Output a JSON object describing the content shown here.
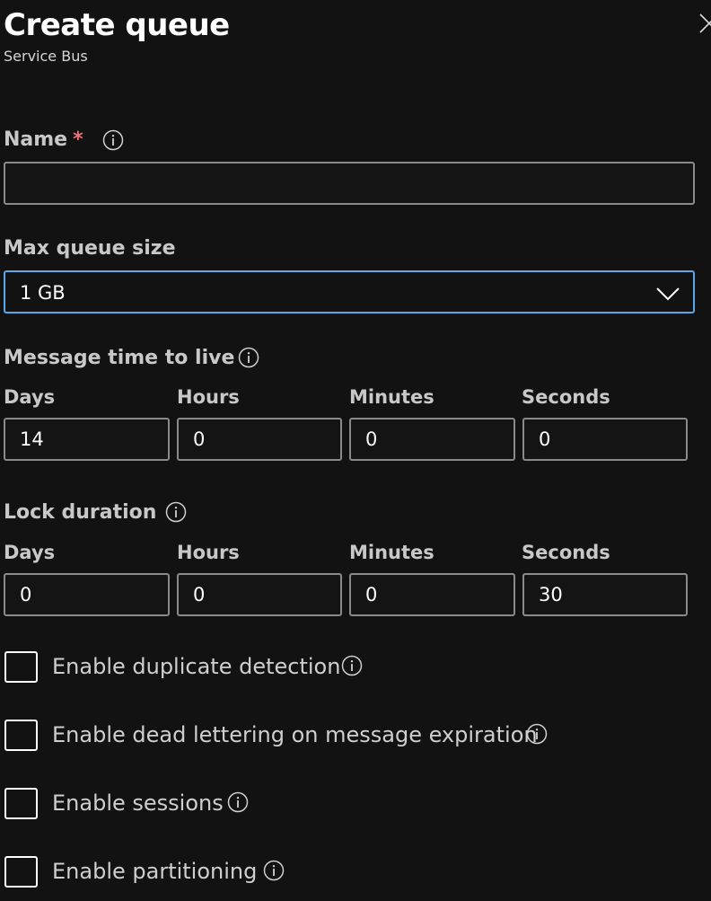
{
  "header": {
    "title": "Create queue",
    "subtitle": "Service Bus"
  },
  "name_field": {
    "label": "Name",
    "required_marker": "*",
    "value": ""
  },
  "max_queue_size": {
    "label": "Max queue size",
    "selected": "1 GB"
  },
  "message_ttl": {
    "label": "Message time to live",
    "units": {
      "days": "Days",
      "hours": "Hours",
      "minutes": "Minutes",
      "seconds": "Seconds"
    },
    "values": {
      "days": "14",
      "hours": "0",
      "minutes": "0",
      "seconds": "0"
    }
  },
  "lock_duration": {
    "label": "Lock duration",
    "units": {
      "days": "Days",
      "hours": "Hours",
      "minutes": "Minutes",
      "seconds": "Seconds"
    },
    "values": {
      "days": "0",
      "hours": "0",
      "minutes": "0",
      "seconds": "30"
    }
  },
  "options": [
    {
      "label": "Enable duplicate detection",
      "checked": false
    },
    {
      "label": "Enable dead lettering on message expiration",
      "checked": false
    },
    {
      "label": "Enable sessions",
      "checked": false
    },
    {
      "label": "Enable partitioning",
      "checked": false
    }
  ],
  "icons": {
    "close": "close-icon",
    "info": "info-icon",
    "chevron": "chevron-down-icon"
  },
  "colors": {
    "background": "#121212",
    "focus_border": "#5aa7ea",
    "required": "#f1707b"
  }
}
